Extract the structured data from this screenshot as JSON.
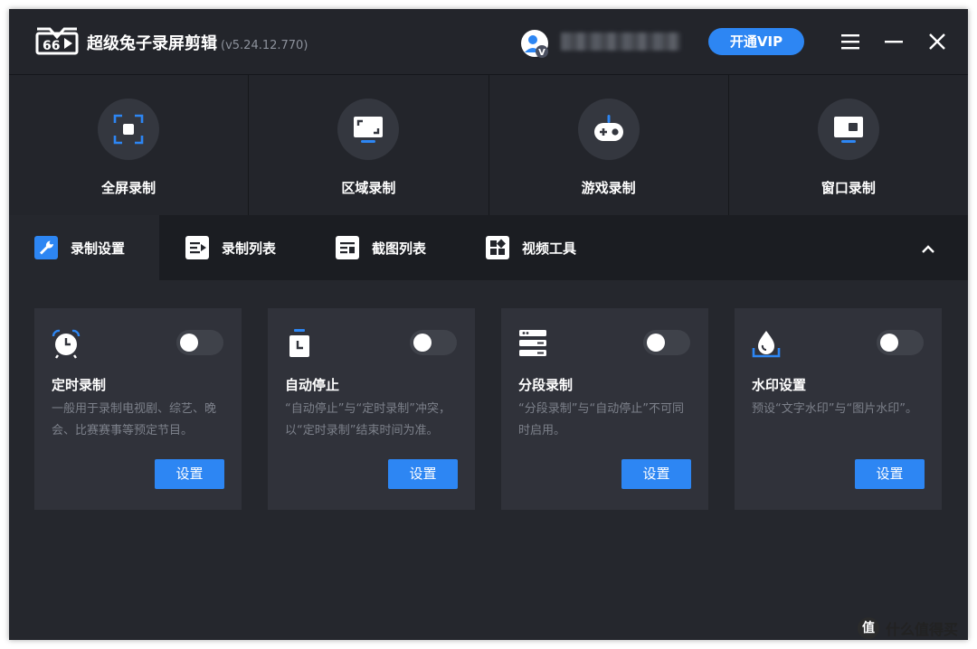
{
  "app": {
    "title": "超级兔子录屏剪辑",
    "version": "(v5.24.12.770)",
    "vip_label": "开通VIP",
    "avatar_badge": "V"
  },
  "modes": [
    {
      "label": "全屏录制",
      "icon": "fullscreen-icon"
    },
    {
      "label": "区域录制",
      "icon": "region-icon"
    },
    {
      "label": "游戏录制",
      "icon": "gamepad-icon"
    },
    {
      "label": "窗口录制",
      "icon": "window-icon"
    }
  ],
  "tabs": [
    {
      "label": "录制设置",
      "icon": "wrench-icon",
      "active": true
    },
    {
      "label": "录制列表",
      "icon": "record-list-icon",
      "active": false
    },
    {
      "label": "截图列表",
      "icon": "screenshot-list-icon",
      "active": false
    },
    {
      "label": "视频工具",
      "icon": "video-tools-icon",
      "active": false
    }
  ],
  "cards": [
    {
      "title": "定时录制",
      "desc": "一般用于录制电视剧、综艺、晚会、比赛赛事等预定节目。",
      "button": "设置",
      "enabled": false,
      "icon": "alarm-clock-icon"
    },
    {
      "title": "自动停止",
      "desc": "“自动停止”与“定时录制”冲突，以“定时录制”结束时间为准。",
      "button": "设置",
      "enabled": false,
      "icon": "stopwatch-icon"
    },
    {
      "title": "分段录制",
      "desc": "“分段录制”与“自动停止”不可同时启用。",
      "button": "设置",
      "enabled": false,
      "icon": "segment-icon"
    },
    {
      "title": "水印设置",
      "desc": "预设“文字水印”与“图片水印”。",
      "button": "设置",
      "enabled": false,
      "icon": "watermark-icon"
    }
  ],
  "watermark": {
    "logo": "值",
    "text": "什么值得买"
  },
  "colors": {
    "accent": "#2d86f3",
    "background": "#1b1d22",
    "panel": "#25272d",
    "card": "#30323a"
  }
}
